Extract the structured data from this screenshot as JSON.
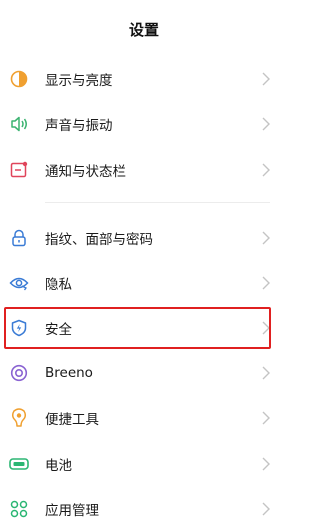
{
  "header": {
    "title": "设置"
  },
  "items": [
    {
      "label": "显示与亮度",
      "icon": "display-brightness-icon"
    },
    {
      "label": "声音与振动",
      "icon": "speaker-icon"
    },
    {
      "label": "通知与状态栏",
      "icon": "notification-icon"
    },
    {
      "label": "指纹、面部与密码",
      "icon": "lock-icon"
    },
    {
      "label": "隐私",
      "icon": "privacy-eye-icon"
    },
    {
      "label": "安全",
      "icon": "shield-icon",
      "highlighted": true
    },
    {
      "label": "Breeno",
      "icon": "breeno-icon"
    },
    {
      "label": "便捷工具",
      "icon": "tools-icon"
    },
    {
      "label": "电池",
      "icon": "battery-icon"
    },
    {
      "label": "应用管理",
      "icon": "app-management-icon"
    }
  ],
  "colors": {
    "highlight_border": "#e02020",
    "display": "#f0a030",
    "sound": "#3cb371",
    "notification": "#e0445a",
    "fingerprint": "#3a7bd5",
    "privacy": "#3a7bd5",
    "security": "#3a7bd5",
    "breeno": "#8a63d2",
    "tools": "#f0a030",
    "battery": "#2bb673",
    "apps": "#2bb673"
  }
}
